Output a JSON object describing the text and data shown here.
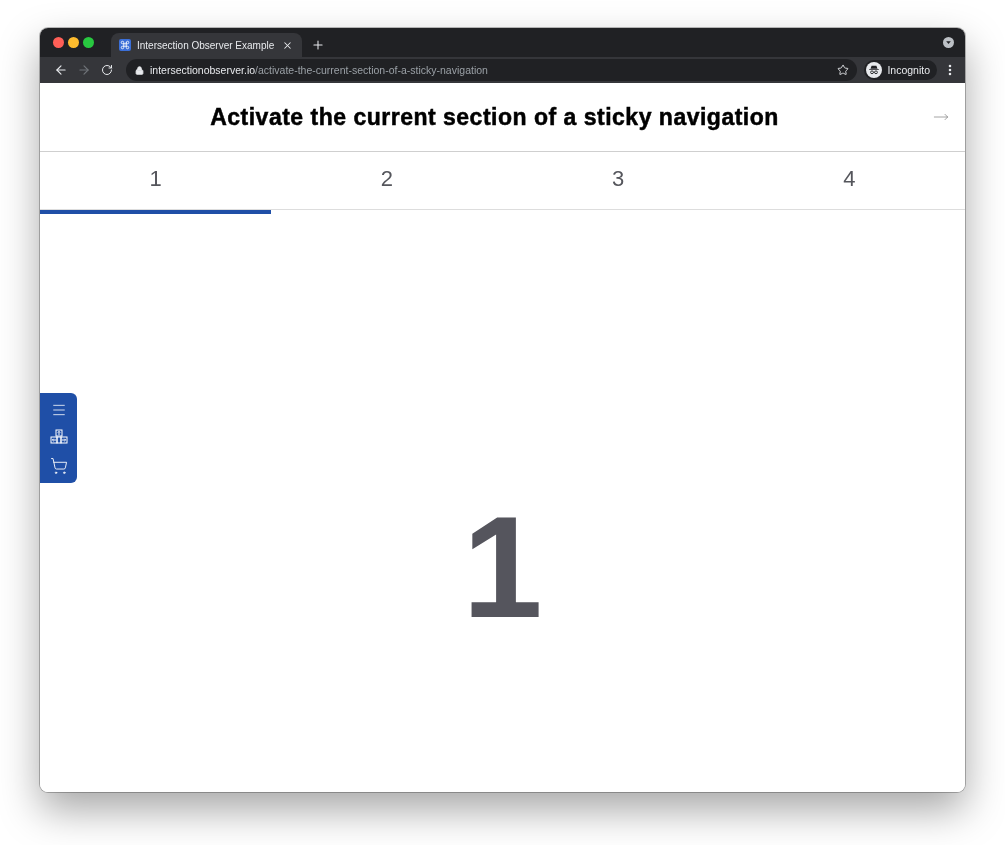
{
  "browser": {
    "tabs": [
      {
        "title": "Intersection Observer Example",
        "selected": true
      }
    ],
    "nav_buttons": [
      {
        "kind": "back",
        "disabled": false
      },
      {
        "kind": "forward",
        "disabled": true
      },
      {
        "kind": "reload",
        "disabled": false
      }
    ],
    "url": {
      "host": "intersectionobserver.io",
      "path": "/activate-the-current-section-of-a-sticky-navigation"
    },
    "profile": "Incognito"
  },
  "page": {
    "title": "Activate the current section of a sticky navigation",
    "nav": [
      {
        "label": "1",
        "selected": true
      },
      {
        "label": "2",
        "selected": false
      },
      {
        "label": "3",
        "selected": false
      },
      {
        "label": "4",
        "selected": false
      }
    ],
    "sidebar": [
      {
        "kind": "menu"
      },
      {
        "kind": "keys"
      },
      {
        "kind": "cart"
      }
    ],
    "section": {
      "heading": "1"
    }
  }
}
